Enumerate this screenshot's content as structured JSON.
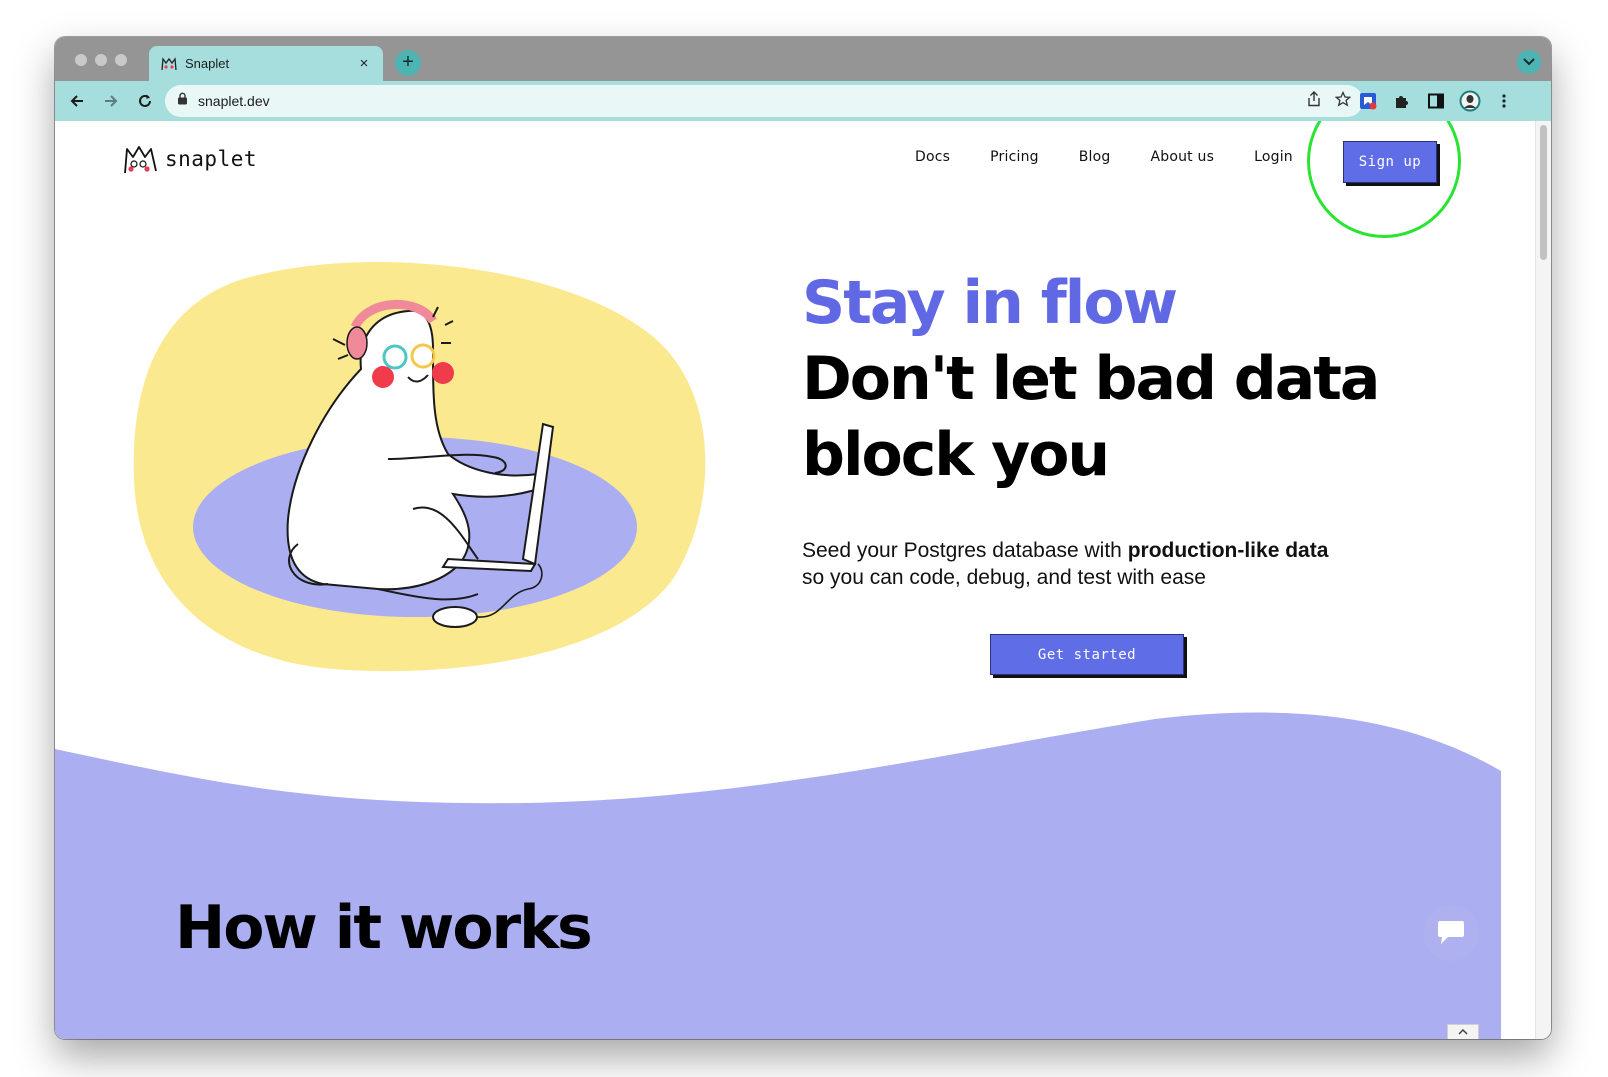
{
  "browser": {
    "tab_title": "Snaplet",
    "tab_close": "×",
    "new_tab": "+",
    "url": "snaplet.dev"
  },
  "site": {
    "logo_text": "snaplet",
    "nav": [
      {
        "label": "Docs"
      },
      {
        "label": "Pricing"
      },
      {
        "label": "Blog"
      },
      {
        "label": "About us"
      },
      {
        "label": "Login"
      }
    ],
    "signup_label": "Sign up"
  },
  "hero": {
    "accent": "Stay in flow",
    "line1": "Don't let bad data",
    "line2": "block you",
    "sub_pre": "Seed your Postgres database with ",
    "sub_bold": "production-like data",
    "sub_post": "so you can code, debug, and test with ease",
    "cta": "Get started"
  },
  "section": {
    "title": "How it works"
  },
  "colors": {
    "accent": "#6068e4",
    "button": "#5f6de6",
    "yellow_blob": "#fbe98f",
    "lavender": "#abaef0",
    "tab_bg": "#a5dedd",
    "highlight": "#2be432"
  }
}
